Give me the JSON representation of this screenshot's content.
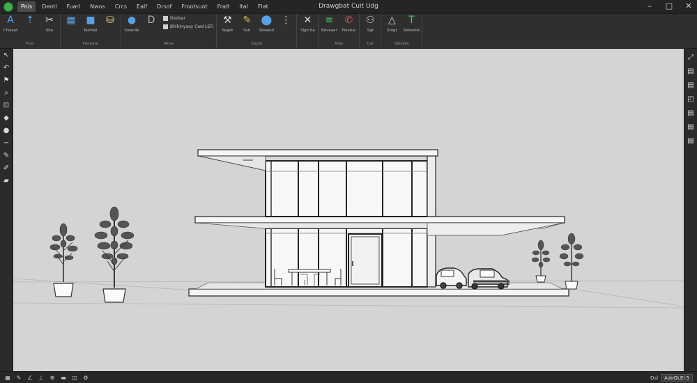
{
  "window": {
    "title": "Drawgbat Cuit Udg",
    "controls": [
      "–",
      "□",
      "✕"
    ]
  },
  "menu": {
    "items": [
      {
        "label": "Pnis",
        "active": true
      },
      {
        "label": "Deotl",
        "active": false
      },
      {
        "label": "Fuarl",
        "active": false
      },
      {
        "label": "Nwos",
        "active": false
      },
      {
        "label": "Crcs",
        "active": false
      },
      {
        "label": "Ealf",
        "active": false
      },
      {
        "label": "Drsof",
        "active": false
      },
      {
        "label": "Frootsuot",
        "active": false
      },
      {
        "label": "Fralt",
        "active": false
      },
      {
        "label": "Ital",
        "active": false
      },
      {
        "label": "Flat",
        "active": false
      }
    ]
  },
  "ribbon": {
    "groups": [
      {
        "label": "Pusi",
        "tools": [
          {
            "icon": "pointer-a-icon",
            "glyph": "A",
            "label": "Chsleat",
            "color": "#5aa0e6"
          },
          {
            "icon": "pin-tool-icon",
            "glyph": "⇡",
            "label": "",
            "color": "#5aa0e6"
          },
          {
            "icon": "scissors-icon",
            "glyph": "✂",
            "label": "Sbo",
            "color": "#d8d8d8"
          }
        ]
      },
      {
        "label": "Foonant",
        "tools": [
          {
            "icon": "grid-icon",
            "glyph": "▦",
            "label": "",
            "color": "#5aa0e6"
          },
          {
            "icon": "blue-square-icon",
            "glyph": "■",
            "label": "Rurtisll",
            "color": "#5aa0e6"
          },
          {
            "icon": "paint-bucket-icon",
            "glyph": "⛁",
            "label": "",
            "color": "#d8c46a"
          }
        ]
      },
      {
        "label": "Mnas",
        "tools": [
          {
            "icon": "bubbles-icon",
            "glyph": "●",
            "label": "Sownile",
            "color": "#5aa0e6"
          },
          {
            "icon": "dye-icon",
            "glyph": "D",
            "label": "",
            "color": "#b0b0b0"
          }
        ],
        "stack": [
          {
            "label": "Dodoar",
            "icon": "small-square-icon"
          },
          {
            "label": "Bhlhinyaay Cwd LEFI",
            "icon": "small-square-icon"
          }
        ]
      },
      {
        "label": "Exoid",
        "tools": [
          {
            "icon": "crane-icon",
            "glyph": "⚒",
            "label": "Segot",
            "color": "#d8d8d8"
          },
          {
            "icon": "brush-icon",
            "glyph": "✎",
            "label": "Ssti",
            "color": "#e0b84a"
          },
          {
            "icon": "blue-tag-icon",
            "glyph": "⬤",
            "label": "Sbswed",
            "color": "#5aa0e6"
          },
          {
            "icon": "mini-tools-icon",
            "glyph": "⋮",
            "label": "",
            "color": "#d8d8d8"
          }
        ]
      },
      {
        "label": "",
        "tools": [
          {
            "icon": "close-x-icon",
            "glyph": "✕",
            "label": "Slgh ba",
            "color": "#d8d8d8"
          }
        ]
      },
      {
        "label": "Nloy",
        "tools": [
          {
            "icon": "green-layers-icon",
            "glyph": "≡",
            "label": "Boveaer",
            "color": "#4cc45a"
          },
          {
            "icon": "red-chat-icon",
            "glyph": "✆",
            "label": "Flaonal",
            "color": "#e05050"
          }
        ]
      },
      {
        "label": "Car",
        "tools": [
          {
            "icon": "link-icon",
            "glyph": "⚇",
            "label": "Sgt",
            "color": "#d8d8d8"
          }
        ]
      },
      {
        "label": "Sstvete",
        "tools": [
          {
            "icon": "triangle-icon",
            "glyph": "△",
            "label": "Srogt",
            "color": "#d8d8d8"
          },
          {
            "icon": "green-t-icon",
            "glyph": "T",
            "label": "Sbbostle",
            "color": "#4cc45a"
          }
        ]
      }
    ]
  },
  "left_toolbar": [
    {
      "icon": "arrow-select-icon",
      "glyph": "↖"
    },
    {
      "icon": "undo-icon",
      "glyph": "↶"
    },
    {
      "icon": "flag-icon",
      "glyph": "⚑"
    },
    {
      "icon": "magnify-icon",
      "glyph": "⌕"
    },
    {
      "icon": "shape-tool-icon",
      "glyph": "⊡"
    },
    {
      "icon": "tag-icon",
      "glyph": "◆"
    },
    {
      "icon": "sphere-icon",
      "glyph": "●"
    },
    {
      "icon": "sketch-icon",
      "glyph": "∽"
    },
    {
      "icon": "pen-icon",
      "glyph": "✎"
    },
    {
      "icon": "pencil-icon",
      "glyph": "✐"
    },
    {
      "icon": "eraser-icon",
      "glyph": "▰"
    }
  ],
  "right_toolbar": [
    {
      "icon": "expand-icon",
      "glyph": "⤢"
    },
    {
      "icon": "panel-icon",
      "glyph": "▤"
    },
    {
      "icon": "panel-alt-icon",
      "glyph": "▤"
    },
    {
      "icon": "camera-icon",
      "glyph": "◰"
    },
    {
      "icon": "panel-icon-2",
      "glyph": "▤"
    },
    {
      "icon": "panel-icon-3",
      "glyph": "▤"
    },
    {
      "icon": "panel-icon-4",
      "glyph": "▤"
    }
  ],
  "status_bar": {
    "tools": [
      {
        "icon": "grid-status-icon",
        "glyph": "▦"
      },
      {
        "icon": "draw-status-icon",
        "glyph": "✎"
      },
      {
        "icon": "angle-status-icon",
        "glyph": "∠"
      },
      {
        "icon": "ortho-status-icon",
        "glyph": "⊥"
      },
      {
        "icon": "snap-status-icon",
        "glyph": "⊕"
      },
      {
        "icon": "lineweight-status-icon",
        "glyph": "▬"
      },
      {
        "icon": "layer-status-icon",
        "glyph": "◫"
      },
      {
        "icon": "settings-status-icon",
        "glyph": "⚙"
      }
    ],
    "left_text": "Dsl",
    "value_text": "AdoOLEI 5"
  }
}
